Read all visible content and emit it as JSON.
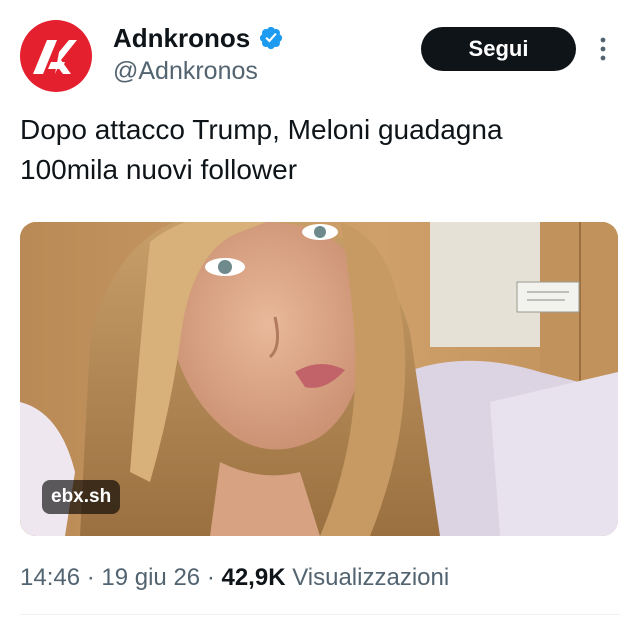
{
  "author": {
    "display_name": "Adnkronos",
    "handle": "@Adnkronos",
    "avatar_icon": "adnkronos-logo",
    "verified_icon": "verified-badge-icon",
    "brand_color": "#e4202e",
    "verified_color": "#1d9bf0"
  },
  "actions": {
    "follow_label": "Segui",
    "more_icon": "more-vertical-icon"
  },
  "tweet": {
    "text": "Dopo attacco Trump, Meloni guadagna\n100mila nuovi follower"
  },
  "media": {
    "type": "video-thumbnail",
    "source_badge": "ebx.sh"
  },
  "meta": {
    "time": "14:46",
    "sep1": " · ",
    "date": "19 giu 26",
    "sep2": " · ",
    "views_count": "42,9K",
    "views_label": " Visualizzazioni"
  }
}
